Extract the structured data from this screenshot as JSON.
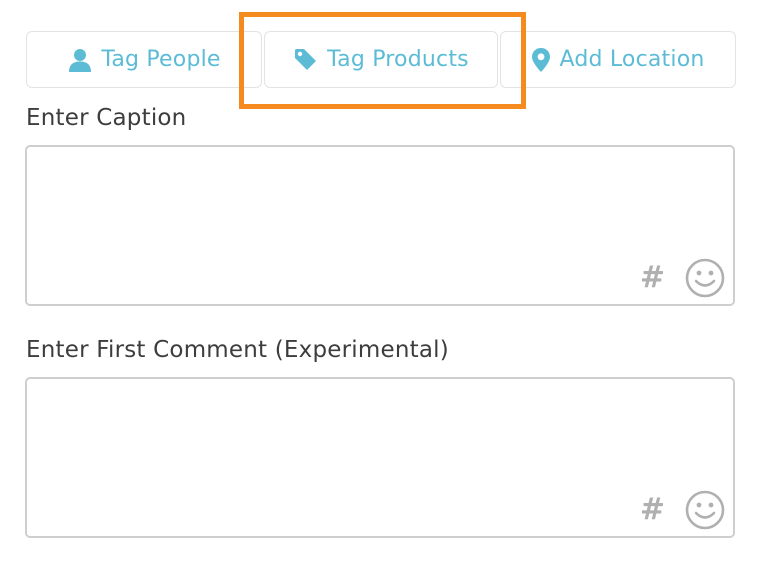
{
  "tabs": [
    {
      "label": "Tag People",
      "icon": "person-icon"
    },
    {
      "label": "Tag Products",
      "icon": "tag-icon"
    },
    {
      "label": "Add Location",
      "icon": "location-pin-icon"
    }
  ],
  "caption": {
    "label": "Enter Caption",
    "value": "",
    "hashtag_symbol": "#",
    "emoji_icon": "smiley-icon"
  },
  "first_comment": {
    "label": "Enter First Comment (Experimental)",
    "value": "",
    "hashtag_symbol": "#",
    "emoji_icon": "smiley-icon"
  },
  "colors": {
    "tab_text": "#5cbcd6",
    "highlight": "#f58a1f",
    "field_border": "#cfcfcf",
    "icon_gray": "#b0b0b0"
  }
}
